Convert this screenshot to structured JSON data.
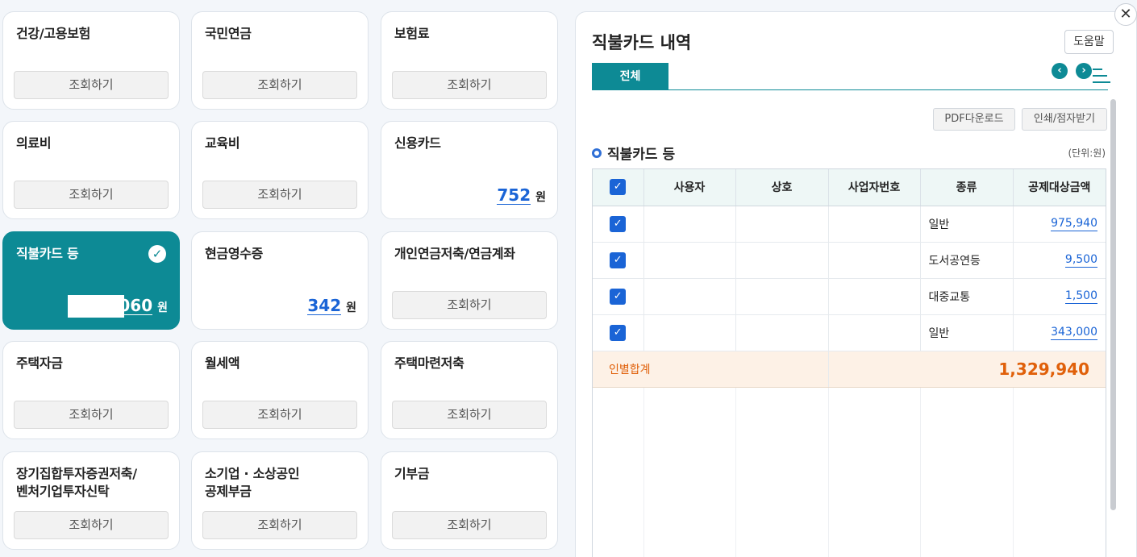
{
  "cards": [
    {
      "title": "건강/고용보험",
      "button": "조회하기"
    },
    {
      "title": "국민연금",
      "button": "조회하기"
    },
    {
      "title": "보험료",
      "button": "조회하기"
    },
    {
      "title": "의료비",
      "button": "조회하기"
    },
    {
      "title": "교육비",
      "button": "조회하기"
    },
    {
      "title": "신용카드",
      "amount": "752",
      "unit": "원"
    },
    {
      "title": "직불카드 등",
      "amount": "060",
      "unit": "원"
    },
    {
      "title": "현금영수증",
      "amount": "342",
      "unit": "원"
    },
    {
      "title": "개인연금저축/연금계좌",
      "button": "조회하기"
    },
    {
      "title": "주택자금",
      "button": "조회하기"
    },
    {
      "title": "월세액",
      "button": "조회하기"
    },
    {
      "title": "주택마련저축",
      "button": "조회하기"
    },
    {
      "title": "장기집합투자증권저축/\n벤처기업투자신탁",
      "button": "조회하기"
    },
    {
      "title": "소기업 · 소상공인\n공제부금",
      "button": "조회하기"
    },
    {
      "title": "기부금",
      "button": "조회하기"
    }
  ],
  "panel": {
    "title": "직불카드 내역",
    "help": "도움말",
    "tab": "전체",
    "pdf_button": "PDF다운로드",
    "print_button": "인쇄/점자받기",
    "section_title": "직불카드 등",
    "unit_label": "(단위:원)",
    "columns": [
      "사용자",
      "상호",
      "사업자번호",
      "종류",
      "공제대상금액"
    ],
    "rows": [
      {
        "type": "일반",
        "amount": "975,940"
      },
      {
        "type": "도서공연등",
        "amount": "9,500"
      },
      {
        "type": "대중교통",
        "amount": "1,500"
      },
      {
        "type": "일반",
        "amount": "343,000"
      }
    ],
    "total_label": "인별합계",
    "total_value": "1,329,940"
  },
  "colors": {
    "accent": "#0d8a95",
    "link": "#1a64d6",
    "total": "#e0600a"
  }
}
